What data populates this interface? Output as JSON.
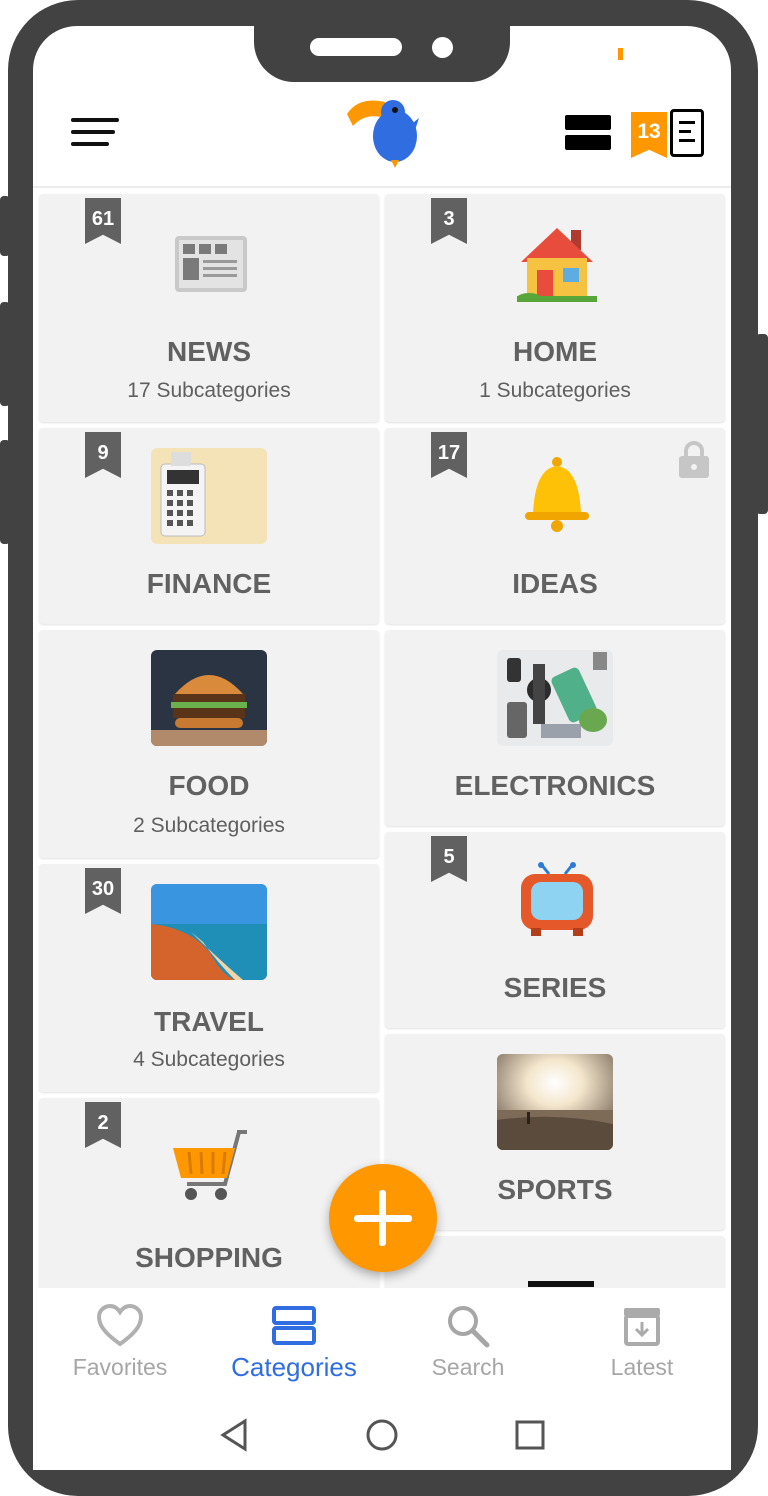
{
  "app": {
    "name": "Categories",
    "accent_color": "#ff9800",
    "active_color": "#2f6de1",
    "badge_count": "13"
  },
  "header": {
    "menu_icon": "hamburger-menu-icon",
    "logo_icon": "toucan-logo-icon",
    "view_mode_icon": "list-view-icon",
    "notes_icon": "document-icon"
  },
  "categories": [
    {
      "title": "NEWS",
      "subtitle": "17 Subcategories",
      "count": "61",
      "image": "newspaper-icon"
    },
    {
      "title": "HOME",
      "subtitle": "1 Subcategories",
      "count": "3",
      "image": "house-icon"
    },
    {
      "title": "FINANCE",
      "subtitle": "",
      "count": "9",
      "image": "calculator-photo"
    },
    {
      "title": "IDEAS",
      "subtitle": "",
      "count": "17",
      "image": "bell-icon",
      "locked": true
    },
    {
      "title": "FOOD",
      "subtitle": "2 Subcategories",
      "count": "",
      "image": "burger-photo"
    },
    {
      "title": "ELECTRONICS",
      "subtitle": "",
      "count": "",
      "image": "gadgets-photo"
    },
    {
      "title": "TRAVEL",
      "subtitle": "4 Subcategories",
      "count": "30",
      "image": "beach-photo"
    },
    {
      "title": "SERIES",
      "subtitle": "",
      "count": "5",
      "image": "tv-icon"
    },
    {
      "title": "SHOPPING",
      "subtitle": "",
      "count": "2",
      "image": "shopping-cart-icon"
    },
    {
      "title": "SPORTS",
      "subtitle": "",
      "count": "",
      "image": "sunset-beach-photo"
    }
  ],
  "fab": {
    "icon": "plus-icon"
  },
  "bottom_nav": [
    {
      "label": "Favorites",
      "icon": "heart-icon",
      "active": false
    },
    {
      "label": "Categories",
      "icon": "categories-icon",
      "active": true
    },
    {
      "label": "Search",
      "icon": "search-icon",
      "active": false
    },
    {
      "label": "Latest",
      "icon": "archive-icon",
      "active": false
    }
  ],
  "system_nav": {
    "back": "back-icon",
    "home": "home-icon",
    "recents": "recents-icon"
  }
}
